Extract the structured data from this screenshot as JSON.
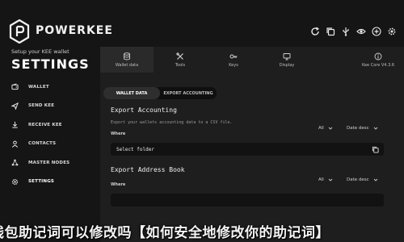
{
  "app": {
    "brand": "POWERKEE"
  },
  "top_icons": [
    "refresh-icon",
    "copy-icon",
    "usb-icon",
    "eye-icon",
    "plus-icon",
    "settings-icon"
  ],
  "sidebar": {
    "subtitle": "Setup your KEE wallet",
    "title": "SETTINGS",
    "items": [
      {
        "label": "WALLET",
        "icon": "wallet-icon"
      },
      {
        "label": "SEND KEE",
        "icon": "send-icon"
      },
      {
        "label": "RECEIVE KEE",
        "icon": "receive-icon"
      },
      {
        "label": "CONTACTS",
        "icon": "contacts-icon"
      },
      {
        "label": "MASTER NODES",
        "icon": "masternodes-icon"
      },
      {
        "label": "SETTINGS",
        "icon": "settings-icon",
        "active": true
      }
    ]
  },
  "main": {
    "tabs": [
      {
        "label": "Wallet data",
        "icon": "database-icon",
        "active": true
      },
      {
        "label": "Tools",
        "icon": "tools-icon"
      },
      {
        "label": "Keys",
        "icon": "key-icon"
      },
      {
        "label": "Display",
        "icon": "display-icon"
      }
    ],
    "version_tab": {
      "label": "Kee Core V4.3.6",
      "icon": "info-icon"
    },
    "subtabs": [
      {
        "label": "WALLET DATA",
        "active": true
      },
      {
        "label": "EXPORT ACCOUNTING"
      }
    ],
    "export_accounting": {
      "title": "Export Accounting",
      "description": "Export your wallets accounting data to a CSV file.",
      "where_label": "Where",
      "filter_all": "All",
      "filter_sort": "Date desc",
      "placeholder": "Select folder"
    },
    "export_address_book": {
      "title": "Export Address Book",
      "where_label": "Where",
      "filter_all": "All",
      "filter_sort": "Date desc"
    }
  },
  "overlay": {
    "banner": "钱包助记词可以修改吗【如何安全地修改你的助记词】"
  },
  "colors": {
    "background": "#151515",
    "panel": "#1e1e1e",
    "input": "#121212",
    "text": "#e6e6e6"
  }
}
